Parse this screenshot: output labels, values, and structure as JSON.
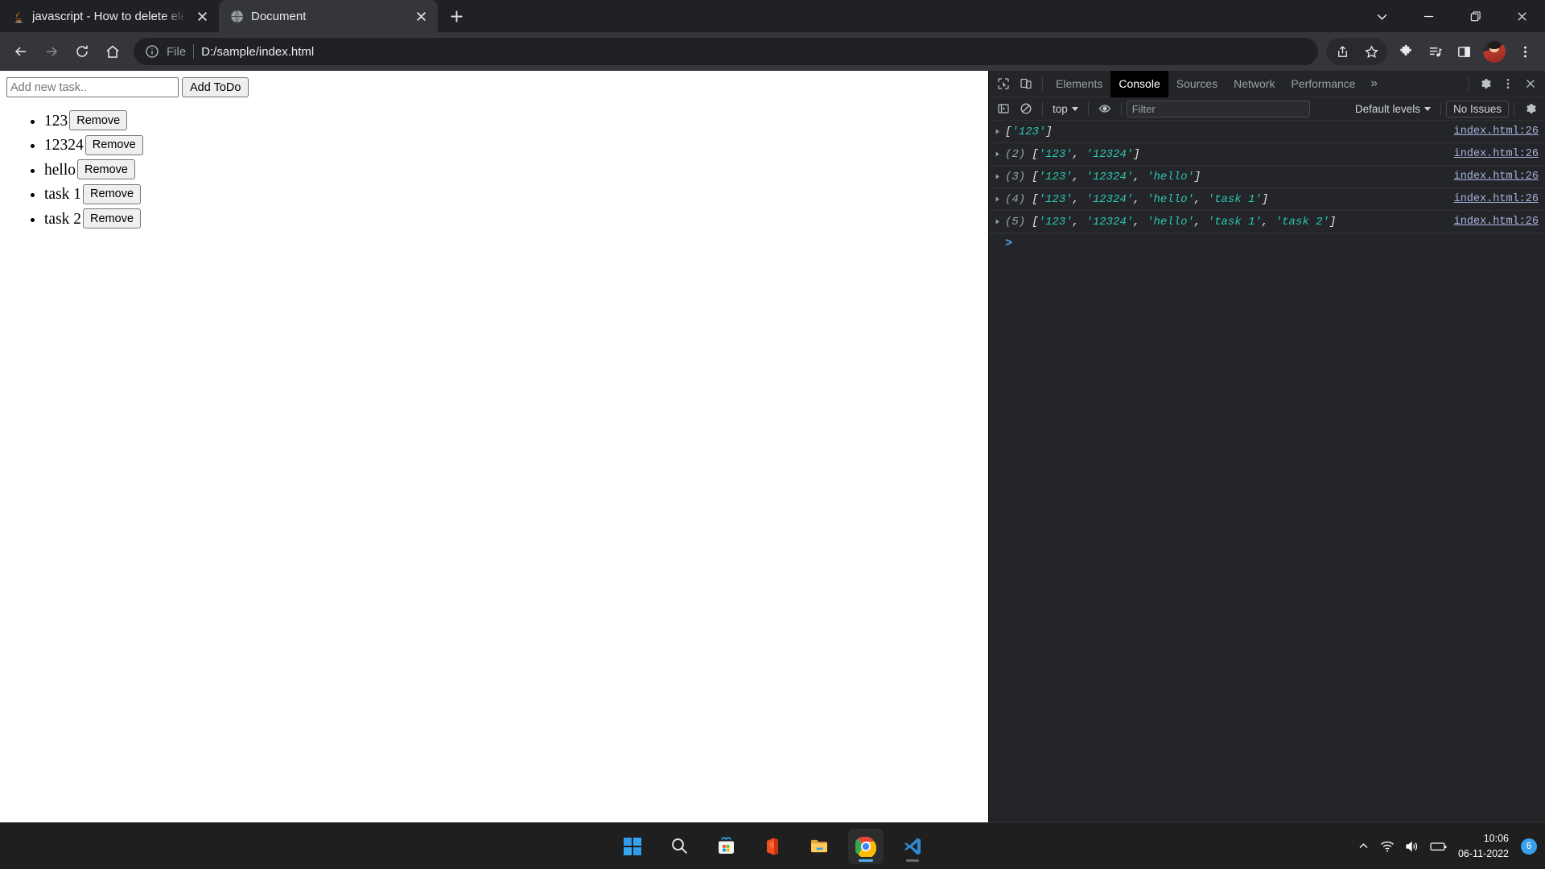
{
  "browser": {
    "tabs": [
      {
        "title": "javascript - How to delete elemen",
        "favicon": "java-icon",
        "active": false
      },
      {
        "title": "Document",
        "favicon": "globe-icon",
        "active": true
      }
    ],
    "new_tab_label": "+",
    "window_controls": [
      "chevron-down-icon",
      "minimize-icon",
      "restore-icon",
      "close-icon"
    ],
    "nav": {
      "back": "back-arrow-icon",
      "forward": "forward-arrow-icon",
      "reload": "reload-icon",
      "home": "home-icon"
    },
    "omnibox": {
      "info_icon": "info-circle-icon",
      "scheme_label": "File",
      "url": "D:/sample/index.html"
    },
    "toolbar_right": [
      "share-icon",
      "bookmark-star-icon",
      "extensions-puzzle-icon",
      "media-playlist-icon",
      "side-panel-icon",
      "avatar",
      "more-vertical-icon"
    ]
  },
  "page": {
    "input_placeholder": "Add new task..",
    "input_value": "",
    "add_button_label": "Add ToDo",
    "remove_button_label": "Remove",
    "todos": [
      "123",
      "12324",
      "hello",
      "task 1",
      "task 2"
    ]
  },
  "devtools": {
    "panel_tabs": [
      {
        "label": "Elements",
        "active": false
      },
      {
        "label": "Console",
        "active": true
      },
      {
        "label": "Sources",
        "active": false
      },
      {
        "label": "Network",
        "active": false
      },
      {
        "label": "Performance",
        "active": false
      }
    ],
    "overflow_label": "»",
    "left_icons": [
      "inspect-element-icon",
      "device-toolbar-icon"
    ],
    "right_icons": [
      "settings-gear-icon",
      "more-vertical-icon",
      "close-icon"
    ],
    "console_toolbar": {
      "sidebar_toggle": "console-sidebar-icon",
      "clear_icon": "clear-console-icon",
      "context": "top",
      "eye_icon": "live-expression-eye-icon",
      "filter_placeholder": "Filter",
      "filter_value": "",
      "levels_label": "Default levels",
      "issues_label": "No Issues",
      "settings_icon": "settings-gear-icon"
    },
    "logs": [
      {
        "count": "",
        "items": [
          "123"
        ],
        "source": "index.html:26"
      },
      {
        "count": "(2)",
        "items": [
          "123",
          "12324"
        ],
        "source": "index.html:26"
      },
      {
        "count": "(3)",
        "items": [
          "123",
          "12324",
          "hello"
        ],
        "source": "index.html:26"
      },
      {
        "count": "(4)",
        "items": [
          "123",
          "12324",
          "hello",
          "task 1"
        ],
        "source": "index.html:26"
      },
      {
        "count": "(5)",
        "items": [
          "123",
          "12324",
          "hello",
          "task 1",
          "task 2"
        ],
        "source": "index.html:26"
      }
    ],
    "prompt_symbol": ">"
  },
  "taskbar": {
    "items": [
      "start-windows-icon",
      "search-icon",
      "microsoft-store-icon",
      "office-icon",
      "file-explorer-icon",
      "google-chrome-icon",
      "vscode-icon"
    ],
    "tray": {
      "overflow_icon": "chevron-up-icon",
      "wifi_icon": "wifi-icon",
      "volume_icon": "volume-icon",
      "battery_icon": "battery-icon",
      "time": "10:06",
      "date": "06-11-2022",
      "notification_count": "6"
    }
  },
  "colors": {
    "chrome_frame": "#202124",
    "chrome_toolbar": "#35363a",
    "devtools_bg": "#242528",
    "console_string": "#29c6b1",
    "console_link": "#a5b3e0",
    "accent_blue": "#3aa0ec"
  }
}
